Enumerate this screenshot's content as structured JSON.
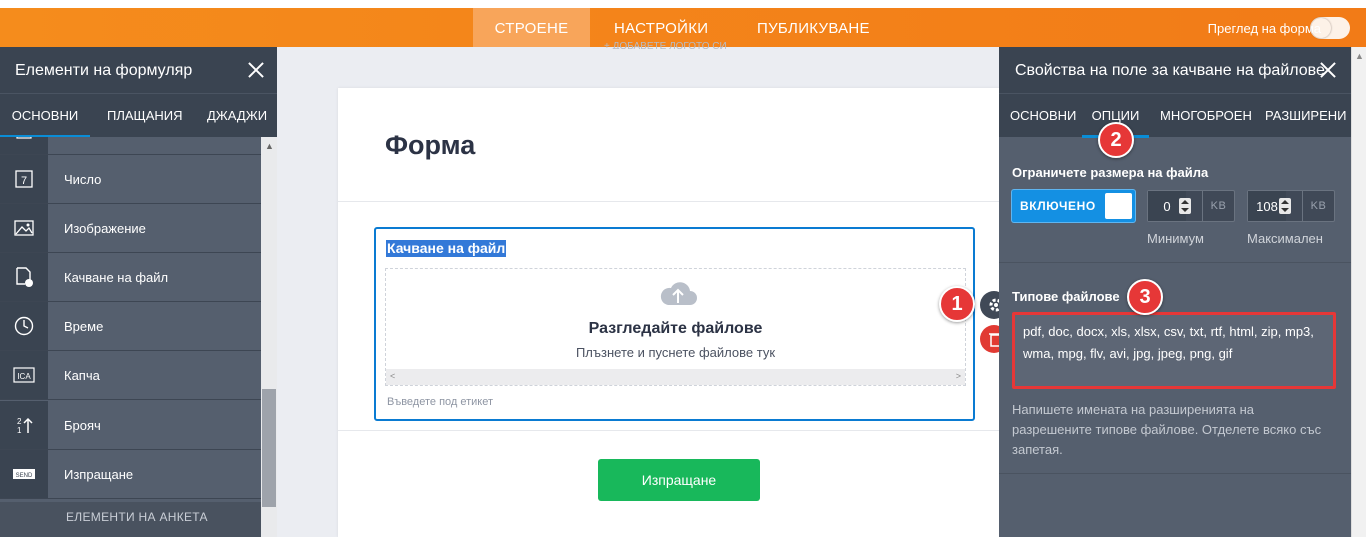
{
  "topbar": {
    "tabs": [
      "СТРОЕНЕ",
      "НАСТРОЙКИ",
      "ПУБЛИКУВАНЕ"
    ],
    "preview_label": "Преглед на форма",
    "add_logo": "+ ДОБАВЕТЕ ЛОГОТО СИ",
    "accent_color": "#f58c1c"
  },
  "left_panel": {
    "title": "Елементи на формуляр",
    "tabs": [
      "ОСНОВНИ",
      "ПЛАЩАНИЯ",
      "ДЖАДЖИ"
    ],
    "items": [
      {
        "label": "Число",
        "icon": "number-icon"
      },
      {
        "label": "Изображение",
        "icon": "image-icon"
      },
      {
        "label": "Качване на файл",
        "icon": "file-upload-icon"
      },
      {
        "label": "Време",
        "icon": "clock-icon"
      },
      {
        "label": "Капча",
        "icon": "captcha-icon"
      },
      {
        "label": "Брояч",
        "icon": "counter-icon"
      },
      {
        "label": "Изпращане",
        "icon": "send-icon"
      }
    ],
    "survey_header": "ЕЛЕМЕНТИ НА АНКЕТА"
  },
  "form": {
    "title": "Форма",
    "upload_label": "Качване на файл",
    "browse_text": "Разгледайте файлове",
    "drag_text": "Плъзнете и пуснете файлове тук",
    "sublabel_placeholder": "Въведете под етикет",
    "submit_label": "Изпращане",
    "submit_color": "#18b85b"
  },
  "right_panel": {
    "title": "Свойства на поле за качване на файлове",
    "tabs": [
      "ОСНОВНИ",
      "ОПЦИИ",
      "МНОГОБРОЕН",
      "РАЗШИРЕНИ"
    ],
    "limit_title": "Ограничете размера на файла",
    "toggle_label": "ВКЛЮЧЕНО",
    "min_value": "0",
    "max_value": "108",
    "unit": "KB",
    "min_label": "Минимум",
    "max_label": "Максимален",
    "types_title": "Типове файлове",
    "types_value": "pdf, doc, docx, xls, xlsx, csv, txt, rtf, html, zip, mp3, wma, mpg, flv, avi, jpg, jpeg, png, gif",
    "types_help": "Напишете имената на разширенията на разрешените типове файлове. Отделете всяко със запетая."
  },
  "annotations": [
    "1",
    "2",
    "3"
  ]
}
